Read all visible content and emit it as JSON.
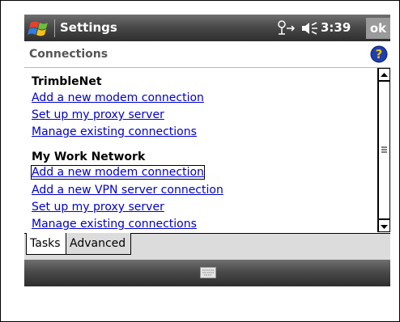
{
  "titlebar": {
    "app_title": "Settings",
    "clock": "3:39",
    "ok_label": "ok",
    "icons": [
      "windows-start-icon",
      "connectivity-icon",
      "volume-icon"
    ]
  },
  "header": {
    "title": "Connections",
    "icons": [
      "help-icon"
    ]
  },
  "groups": [
    {
      "title": "TrimbleNet",
      "links": [
        "Add a new modem connection",
        "Set up my proxy server",
        "Manage existing connections"
      ]
    },
    {
      "title": "My Work Network",
      "links": [
        "Add a new modem connection",
        "Add a new VPN server connection",
        "Set up my proxy server",
        "Manage existing connections"
      ]
    }
  ],
  "tabs": [
    "Tasks",
    "Advanced"
  ],
  "menubar": {
    "icons": [
      "keyboard-icon"
    ]
  },
  "colors": {
    "link": "#0000cc",
    "bar": "#4a4a4a"
  }
}
